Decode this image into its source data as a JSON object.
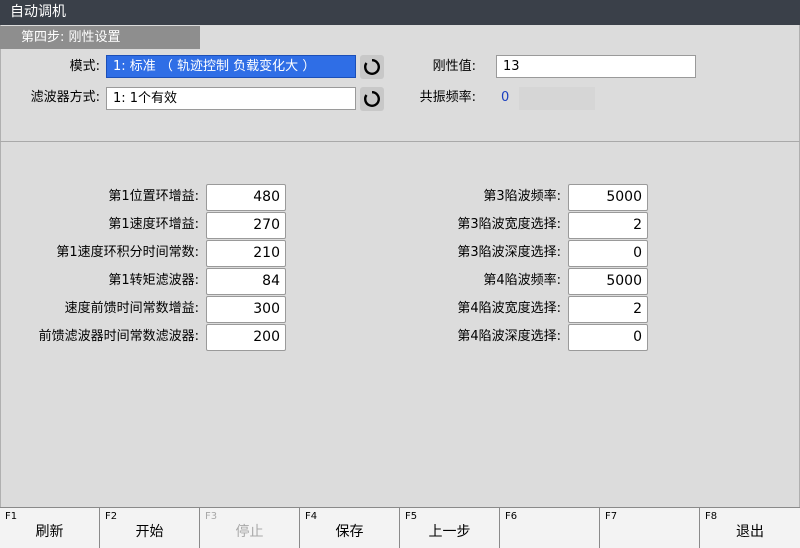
{
  "window": {
    "title": "自动调机"
  },
  "step": {
    "title": "第四步: 刚性设置"
  },
  "settings": {
    "mode_label": "模式:",
    "mode_value": "1: 标准 （ 轨迹控制 负载变化大 ）",
    "filter_label": "滤波器方式:",
    "filter_value": "1: 1个有效",
    "stiffness_label": "刚性值:",
    "stiffness_value": "13",
    "resonance_label": "共振频率:",
    "resonance_value": "0"
  },
  "params_left": [
    {
      "label": "第1位置环增益:",
      "value": "480"
    },
    {
      "label": "第1速度环增益:",
      "value": "270"
    },
    {
      "label": "第1速度环积分时间常数:",
      "value": "210"
    },
    {
      "label": "第1转矩滤波器:",
      "value": "84"
    },
    {
      "label": "速度前馈时间常数增益:",
      "value": "300"
    },
    {
      "label": "前馈滤波器时间常数滤波器:",
      "value": "200"
    }
  ],
  "params_right": [
    {
      "label": "第3陷波频率:",
      "value": "5000"
    },
    {
      "label": "第3陷波宽度选择:",
      "value": "2"
    },
    {
      "label": "第3陷波深度选择:",
      "value": "0"
    },
    {
      "label": "第4陷波频率:",
      "value": "5000"
    },
    {
      "label": "第4陷波宽度选择:",
      "value": "2"
    },
    {
      "label": "第4陷波深度选择:",
      "value": "0"
    }
  ],
  "function_keys": [
    {
      "code": "F1",
      "label": "刷新",
      "enabled": true
    },
    {
      "code": "F2",
      "label": "开始",
      "enabled": true
    },
    {
      "code": "F3",
      "label": "停止",
      "enabled": false
    },
    {
      "code": "F4",
      "label": "保存",
      "enabled": true
    },
    {
      "code": "F5",
      "label": "上一步",
      "enabled": true
    },
    {
      "code": "F6",
      "label": "",
      "enabled": true
    },
    {
      "code": "F7",
      "label": "",
      "enabled": true
    },
    {
      "code": "F8",
      "label": "退出",
      "enabled": true
    }
  ],
  "colors": {
    "titlebar": "#3a4049",
    "selected": "#2f6ee6",
    "value_blue": "#1a3fbf"
  },
  "icons": {
    "refresh": "refresh-icon"
  }
}
